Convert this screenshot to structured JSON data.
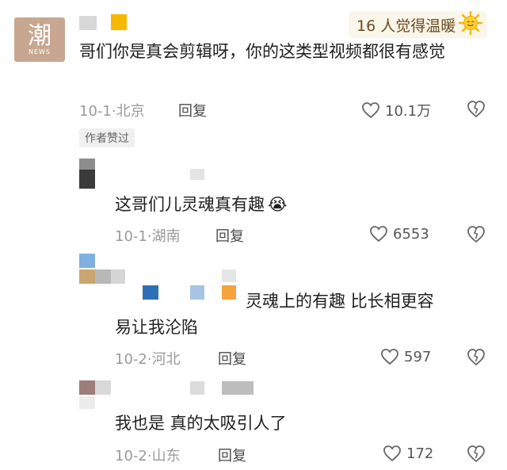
{
  "logo": {
    "glyph": "潮",
    "sub": "NEWS"
  },
  "warm_badge": {
    "text": "16 人觉得温暖",
    "icon": "sun-smile-icon"
  },
  "colors": {
    "pixel_yellow": "#f8b700",
    "pixel_blue": "#2d6fb5",
    "pixel_orange": "#f3a43a",
    "badge_bg": "#f0f0f0"
  },
  "comments": [
    {
      "text": "哥们你是真会剪辑呀，你的这类型视频都很有感觉",
      "date_location": "10-1·北京",
      "reply_label": "回复",
      "likes": "10.1万",
      "author_badge": "作者赞过"
    },
    {
      "text": "这哥们儿灵魂真有趣",
      "emoji": "😭",
      "date_location": "10-1·湖南",
      "reply_label": "回复",
      "likes": "6553"
    },
    {
      "text_line1": "灵魂上的有趣 比长相更容",
      "text_line2": "易让我沦陷",
      "date_location": "10-2·河北",
      "reply_label": "回复",
      "likes": "597"
    },
    {
      "text": "我也是 真的太吸引人了",
      "date_location": "10-2·山东",
      "reply_label": "回复",
      "likes": "172"
    }
  ]
}
